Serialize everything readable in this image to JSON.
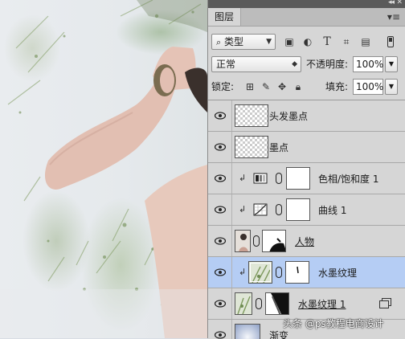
{
  "panel": {
    "tab_label": "图层",
    "filter": {
      "label": "类型",
      "icon": "search-icon"
    },
    "filter_icons": [
      "image-filter-icon",
      "adjustment-filter-icon",
      "type-filter-icon",
      "shape-filter-icon",
      "smart-object-filter-icon"
    ],
    "blend_mode": "正常",
    "opacity_label": "不透明度:",
    "opacity_value": "100%",
    "lock_label": "锁定:",
    "lock_icons": [
      "lock-transparent-icon",
      "lock-image-icon",
      "lock-position-icon",
      "lock-all-icon"
    ],
    "fill_label": "填充:",
    "fill_value": "100%"
  },
  "layers": [
    {
      "name": "头发墨点",
      "thumb": "checker",
      "clipped": false,
      "mask": false,
      "selected": false,
      "underline": false
    },
    {
      "name": "墨点",
      "thumb": "checker",
      "clipped": false,
      "mask": false,
      "selected": false,
      "underline": false
    },
    {
      "name": "色相/饱和度 1",
      "thumb": "hue-saturation",
      "clipped": true,
      "mask": true,
      "selected": false,
      "underline": false
    },
    {
      "name": "曲线 1",
      "thumb": "curves",
      "clipped": true,
      "mask": true,
      "selected": false,
      "underline": false
    },
    {
      "name": "人物",
      "thumb": "person",
      "clipped": false,
      "mask": true,
      "selected": false,
      "underline": true
    },
    {
      "name": "水墨纹理",
      "thumb": "ink-texture",
      "clipped": true,
      "mask": true,
      "selected": true,
      "underline": false
    },
    {
      "name": "水墨纹理 1",
      "thumb": "ink-texture",
      "clipped": false,
      "mask": true,
      "selected": false,
      "underline": true,
      "group_icon": true
    },
    {
      "name": "渐变",
      "thumb": "gradient",
      "clipped": false,
      "mask": false,
      "selected": false,
      "underline": false
    }
  ],
  "watermark": "头条 @ps教程电商设计",
  "colors": {
    "selected_row": "#b5cdf4",
    "panel_bg": "#d6d6d6",
    "ink_green": "#7e9a5e"
  }
}
